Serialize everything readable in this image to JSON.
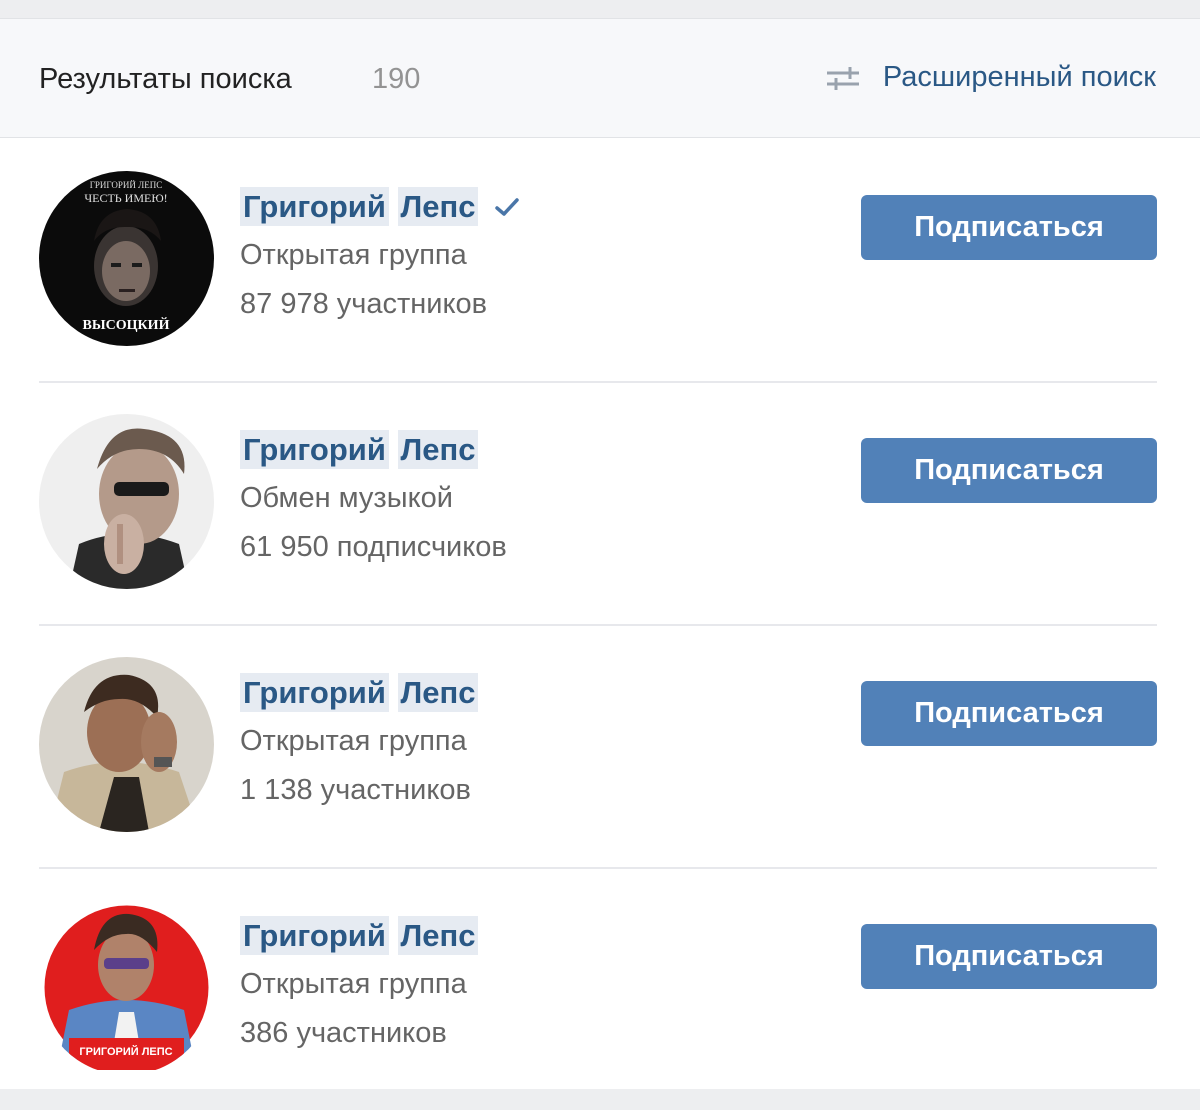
{
  "header": {
    "title": "Результаты поиска",
    "count": "190",
    "advanced_search_label": "Расширенный поиск",
    "advanced_search_icon": "sliders-icon"
  },
  "results": [
    {
      "name_part1": "Григорий",
      "name_part2": "Лепс",
      "verified": true,
      "type": "Открытая группа",
      "members": "87 978 участников",
      "button_label": "Подписаться",
      "avatar_text_top": "ГРИГОРИЙ ЛЕПС",
      "avatar_text_mid": "ЧЕСТЬ ИМЕЮ!",
      "avatar_text_bottom": "ВЫСОЦКИЙ"
    },
    {
      "name_part1": "Григорий",
      "name_part2": "Лепс",
      "verified": false,
      "type": "Обмен музыкой",
      "members": "61 950 подписчиков",
      "button_label": "Подписаться"
    },
    {
      "name_part1": "Григорий",
      "name_part2": "Лепс",
      "verified": false,
      "type": "Открытая группа",
      "members": "1 138 участников",
      "button_label": "Подписаться"
    },
    {
      "name_part1": "Григорий",
      "name_part2": "Лепс",
      "verified": false,
      "type": "Открытая группа",
      "members": "386 участников",
      "button_label": "Подписаться",
      "avatar_text": "ГРИГОРИЙ ЛЕПС"
    }
  ],
  "colors": {
    "accent": "#5181b8",
    "link": "#2a5885",
    "verified": "#4a76a8"
  }
}
